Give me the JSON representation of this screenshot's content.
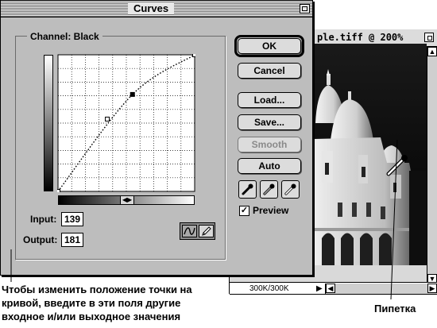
{
  "dialog": {
    "title": "Curves",
    "channel_label": "Channel: Black",
    "input_label": "Input:",
    "input_value": "139",
    "output_label": "Output:",
    "output_value": "181",
    "buttons": {
      "ok": "OK",
      "cancel": "Cancel",
      "load": "Load...",
      "save": "Save...",
      "smooth": "Smooth",
      "auto": "Auto"
    },
    "smooth_enabled": false,
    "preview_label": "Preview",
    "preview_checked": true,
    "active_tool": "curve-tool"
  },
  "curve": {
    "points": [
      [
        0,
        0
      ],
      [
        139,
        181
      ],
      [
        255,
        255
      ]
    ],
    "selected_point": [
      139,
      181
    ]
  },
  "document": {
    "title": "ple.tiff @ 200%",
    "status_size": "300K/300K"
  },
  "annotations": {
    "caption_lines": [
      "Чтобы изменить положение точки на",
      "кривой, введите в эти поля другие",
      "входное и/или выходное значения"
    ],
    "eyedropper_label": "Пипетка"
  },
  "icons": {
    "black_eyedropper": "eyedropper-black-icon",
    "gray_eyedropper": "eyedropper-gray-icon",
    "white_eyedropper": "eyedropper-white-icon",
    "curve_tool": "curve-icon",
    "pencil_tool": "pencil-icon"
  }
}
